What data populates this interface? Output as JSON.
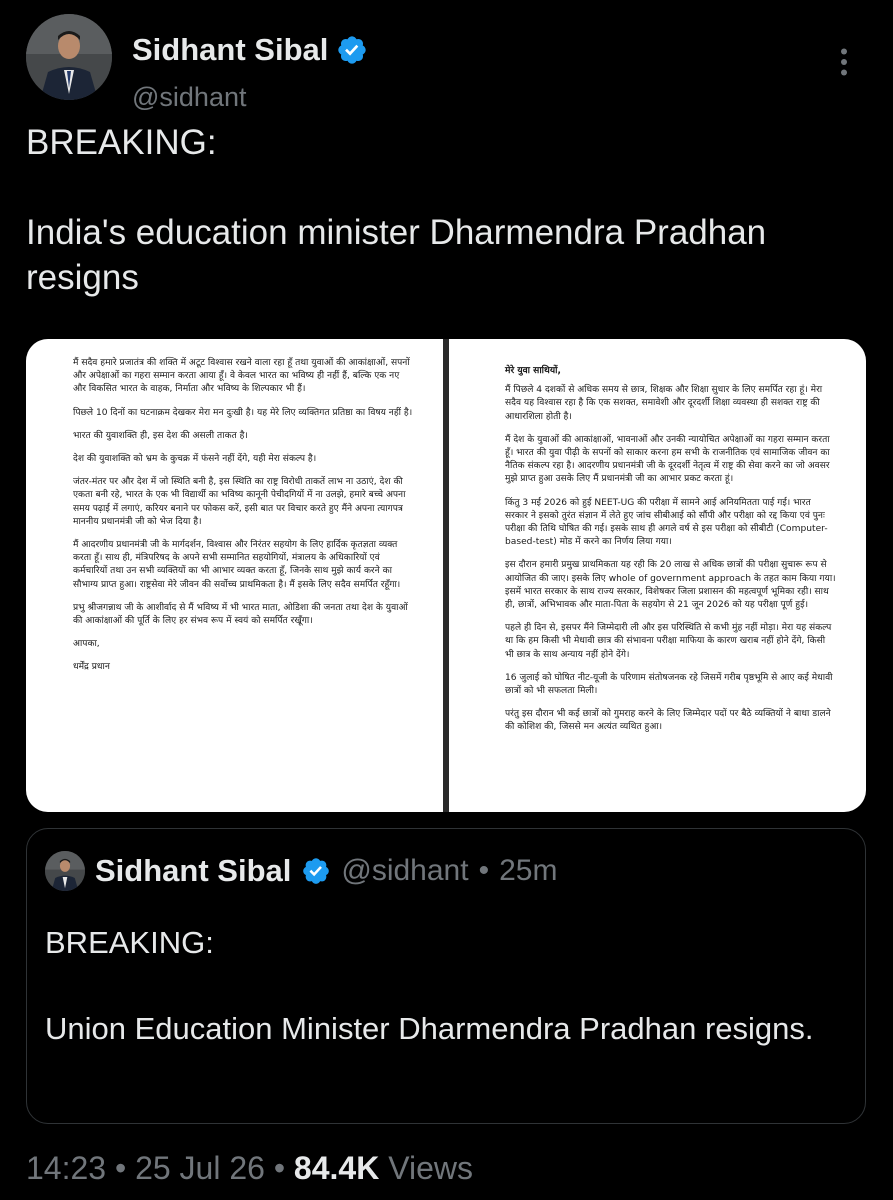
{
  "author": {
    "name": "Sidhant Sibal",
    "handle": "@sidhant"
  },
  "tweet": {
    "text": "BREAKING:\n\nIndia's education minister Dharmendra Pradhan resigns"
  },
  "letter": {
    "left_paragraphs": [
      "मैं सदैव हमारे प्रजातंत्र की शक्ति में अटूट विश्वास रखने वाला रहा हूँ तथा युवाओं की आकांक्षाओं, सपनों और अपेक्षाओं का गहरा सम्मान करता आया हूँ। वे केवल भारत का भविष्य ही नहीं हैं, बल्कि एक नए और विकसित भारत के वाहक, निर्माता और भविष्य के शिल्पकार भी हैं।",
      "पिछले 10 दिनों का घटनाक्रम देखकर मेरा मन दुःखी है। यह मेरे लिए व्यक्तिगत प्रतिष्ठा का विषय नहीं है।",
      "भारत की युवाशक्ति ही, इस देश की असली ताकत है।",
      "देश की युवाशक्ति को भ्रम के कुचक्र में फंसने नहीं देंगे, यही मेरा संकल्प है।",
      "जंतर-मंतर पर और देश में जो स्थिति बनी है, इस स्थिति का राष्ट्र विरोधी ताकतें लाभ ना उठाएं, देश की एकता बनी रहे, भारत के एक भी विद्यार्थी का भविष्य कानूनी पेचीदगियों में ना उलझे, हमारे बच्चे अपना समय पढ़ाई में लगाएं, करियर बनाने पर फोकस करें, इसी बात पर विचार करते हुए मैंने अपना त्यागपत्र माननीय प्रधानमंत्री जी को भेज दिया है।",
      "मैं आदरणीय प्रधानमंत्री जी के मार्गदर्शन, विश्वास और निरंतर सहयोग के लिए हार्दिक कृतज्ञता व्यक्त करता हूँ। साथ ही, मंत्रिपरिषद के अपने सभी सम्मानित सहयोगियों, मंत्रालय के अधिकारियों एवं कर्मचारियों तथा उन सभी व्यक्तियों का भी आभार व्यक्त करता हूँ, जिनके साथ मुझे कार्य करने का सौभाग्य प्राप्त हुआ। राष्ट्रसेवा मेरे जीवन की सर्वोच्च प्राथमिकता है। मैं इसके लिए सदैव समर्पित रहूँगा।",
      "प्रभु श्रीजगन्नाथ जी के आशीर्वाद से मैं भविष्य में भी भारत माता, ओडिशा की जनता तथा देश के युवाओं की आकांक्षाओं की पूर्ति के लिए हर संभव रूप में स्वयं को समर्पित रखूँगा।",
      "आपका,",
      "धर्मेंद्र प्रधान"
    ],
    "salutation": "मेरे युवा साथियों,",
    "right_paragraphs": [
      "मैं पिछले 4 दशकों से अधिक समय से छात्र, शिक्षक और शिक्षा सुधार के लिए समर्पित रहा हूं। मेरा सदैव यह विश्वास रहा है कि एक सशक्त, समावेशी और दूरदर्शी शिक्षा व्यवस्था ही सशक्त राष्ट्र की आधारशिला होती है।",
      "मैं देश के युवाओं की आकांक्षाओं, भावनाओं और उनकी न्यायोचित अपेक्षाओं का गहरा सम्मान करता हूँ। भारत की युवा पीढ़ी के सपनों को साकार करना हम सभी के राजनीतिक एवं सामाजिक जीवन का नैतिक संकल्प रहा है। आदरणीय प्रधानमंत्री जी के दूरदर्शी नेतृत्व में राष्ट्र की सेवा करने का जो अवसर मुझे प्राप्त हुआ उसके लिए मैं प्रधानमंत्री जी का आभार प्रकट करता हूं।",
      "किंतु 3 मई 2026 को हुई NEET-UG की परीक्षा में सामने आई अनियमितता पाई गई। भारत सरकार ने इसको तुरंत संज्ञान में लेते हुए जांच सीबीआई को सौंपी और परीक्षा को रद्द किया एवं पुनः परीक्षा की तिथि घोषित की गई। इसके साथ ही अगले वर्ष से इस परीक्षा को सीबीटी (Computer-based-test) मोड में करने का निर्णय लिया गया।",
      "इस दौरान हमारी प्रमुख प्राथमिकता यह रही कि 20 लाख से अधिक छात्रों की परीक्षा सुचारू रूप से आयोजित की जाए। इसके लिए whole of government approach के तहत काम किया गया। इसमें भारत सरकार के साथ राज्य सरकार, विशेषकर जिला प्रशासन की महत्वपूर्ण भूमिका रही। साथ ही, छात्रों, अभिभावक और माता-पिता के सहयोग से 21 जून 2026 को यह परीक्षा पूर्ण हुई।",
      "पहले ही दिन से, इसपर मैंने जिम्मेदारी ली और इस परिस्थिति से कभी मुंह नहीं मोड़ा। मेरा यह संकल्प था कि हम किसी भी मेधावी छात्र की संभावना परीक्षा माफिया के कारण खराब नहीं होने देंगे, किसी भी छात्र के साथ अन्याय नहीं होने देंगे।",
      "16 जुलाई को घोषित नीट-यूजी के परिणाम संतोषजनक रहे जिसमें गरीब पृष्ठभूमि से आए कई मेधावी छात्रों को भी सफलता मिली।",
      "परंतु इस दौरान भी कई छात्रों को गुमराह करने के लिए जिम्मेदार पदों पर बैठे व्यक्तियों ने बाधा डालने की कोशिश की, जिससे मन अत्यंत व्यथित हुआ।"
    ]
  },
  "quote": {
    "name": "Sidhant Sibal",
    "handle": "@sidhant",
    "separator": "•",
    "time_ago": "25m",
    "text": "BREAKING:\n\nUnion Education Minister Dharmendra Pradhan resigns."
  },
  "meta": {
    "time": "14:23",
    "separator": "•",
    "date": "25 Jul 26",
    "views_count": "84.4K",
    "views_label": "Views"
  },
  "colors": {
    "background": "#000000",
    "text_primary": "#e7e9ea",
    "text_secondary": "#71767b",
    "verified_blue": "#1d9bf0",
    "border": "#2f3336"
  },
  "icons": {
    "verified": "verified-badge-icon",
    "more": "more-horizontal-icon"
  }
}
